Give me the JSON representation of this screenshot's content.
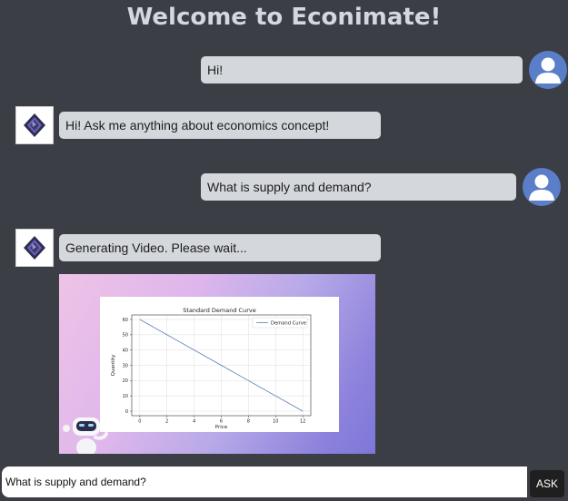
{
  "header": {
    "title": "Welcome to Econimate!"
  },
  "messages": [
    {
      "sender": "user",
      "text": "Hi!"
    },
    {
      "sender": "bot",
      "text": "Hi! Ask me anything about economics concept!"
    },
    {
      "sender": "user",
      "text": "What is supply and demand?"
    },
    {
      "sender": "bot",
      "text": "Generating Video. Please wait..."
    }
  ],
  "video": {
    "chart_data": {
      "type": "line",
      "title": "Standard Demand Curve",
      "xlabel": "Price",
      "ylabel": "Quantity",
      "x": [
        0,
        12
      ],
      "series": [
        {
          "name": "Demand Curve",
          "values": [
            60,
            0
          ]
        }
      ],
      "xlim": [
        0,
        12
      ],
      "ylim": [
        0,
        60
      ],
      "xticks": [
        "0",
        "2",
        "4",
        "6",
        "8",
        "10",
        "12"
      ],
      "yticks": [
        "0",
        "10",
        "20",
        "30",
        "40",
        "50",
        "60"
      ],
      "grid": true,
      "legend": "top-right",
      "line_color": "#5b7fb5"
    }
  },
  "input": {
    "value": "What is supply and demand?"
  },
  "ask_button": {
    "label": "ASK"
  },
  "colors": {
    "background": "#3b3e45",
    "bubble": "#d4d7dc",
    "user_avatar": "#5b7ec9",
    "ask_button": "#1f1f1f"
  }
}
